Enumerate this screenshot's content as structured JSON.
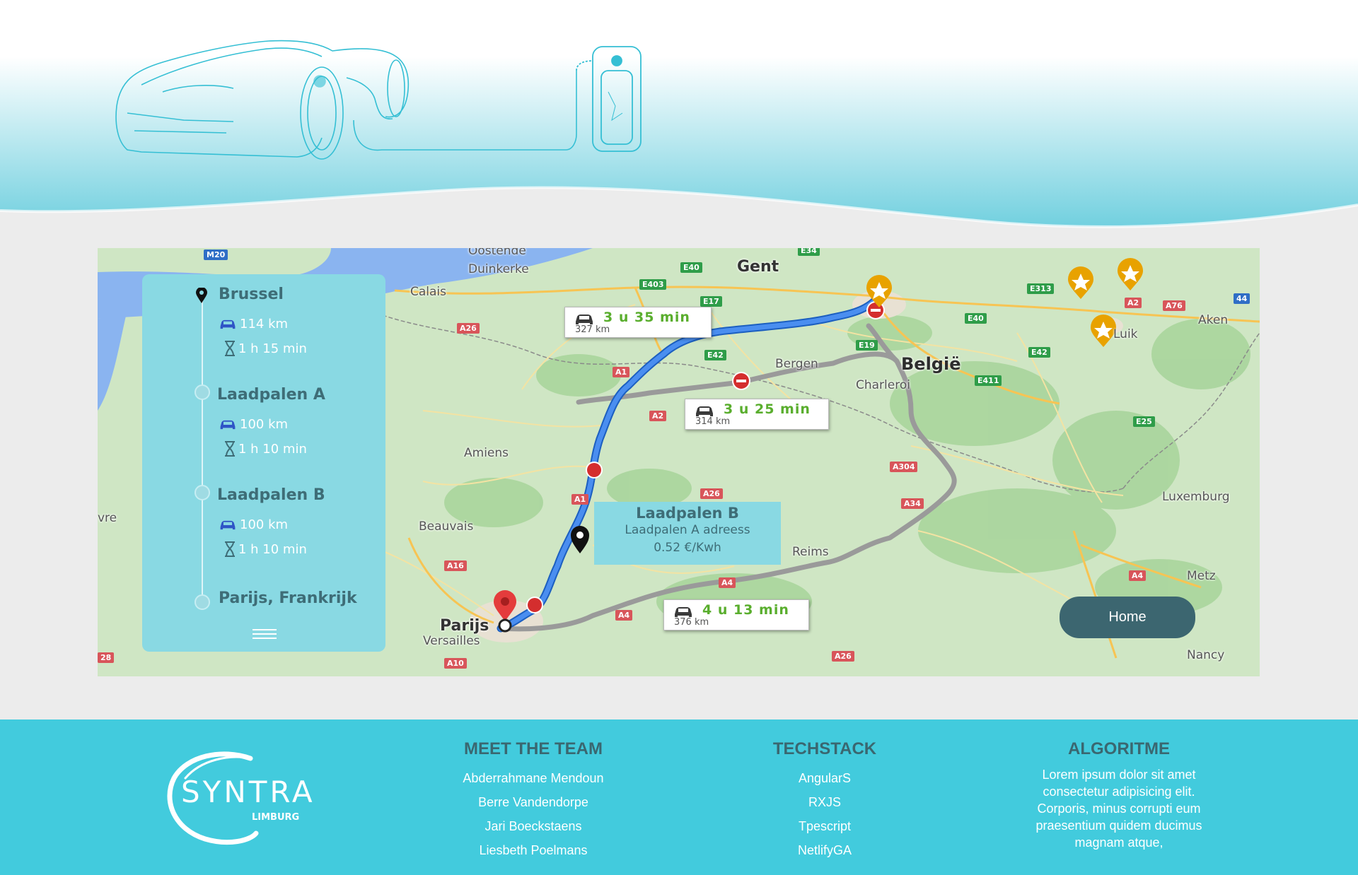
{
  "map": {
    "places": {
      "gent": "Gent",
      "duinkerke": "Duinkerke",
      "calais": "Calais",
      "oostende": "Oostende",
      "bergen": "Bergen",
      "charleroi": "Charleroi",
      "belgie": "België",
      "amiens": "Amiens",
      "beauvais": "Beauvais",
      "parijs": "Parijs",
      "versailles": "Versailles",
      "reims": "Reims",
      "luxemburg": "Luxemburg",
      "metz": "Metz",
      "nancy": "Nancy",
      "aken": "Aken",
      "luik": "Luik",
      "vre": "vre"
    },
    "highways": [
      "M20",
      "E40",
      "E34",
      "E403",
      "E17",
      "E313",
      "A2",
      "A76",
      "44",
      "E40",
      "E42",
      "A1",
      "A26",
      "E19",
      "E42",
      "E411",
      "A2",
      "A304",
      "E25",
      "A26",
      "A1",
      "A34",
      "A16",
      "A4",
      "A4",
      "A4",
      "A10",
      "A26",
      "28"
    ],
    "routes": [
      {
        "time": "3 u 35 min",
        "distance": "327 km"
      },
      {
        "time": "3 u 25 min",
        "distance": "314 km"
      },
      {
        "time": "4 u 13 min",
        "distance": "376 km"
      }
    ],
    "info_popup": {
      "title": "Laadpalen B",
      "address": "Laadpalen A adreess",
      "price": "0.52 €/Kwh"
    },
    "home_label": "Home"
  },
  "route_panel": {
    "stops": [
      {
        "name": "Brussel",
        "distance": "114 km",
        "duration": "1 h 15 min"
      },
      {
        "name": "Laadpalen A",
        "distance": "100 km",
        "duration": "1 h 10 min"
      },
      {
        "name": "Laadpalen B",
        "distance": "100 km",
        "duration": "1 h 10 min"
      },
      {
        "name": "Parijs, Frankrijk"
      }
    ]
  },
  "footer": {
    "logo": {
      "word": "SYNTRA",
      "sub": "LIMBURG"
    },
    "team": {
      "title": "MEET THE TEAM",
      "members": [
        "Abderrahmane Mendoun",
        "Berre Vandendorpe",
        "Jari Boeckstaens",
        "Liesbeth Poelmans"
      ]
    },
    "techstack": {
      "title": "TECHSTACK",
      "items": [
        "AngularS",
        "RXJS",
        "Tpescript",
        "NetlifyGA"
      ]
    },
    "algoritme": {
      "title": "ALGORITME",
      "text": "Lorem ipsum dolor sit amet consectetur adipisicing elit. Corporis, minus corrupti eum praesentium quidem ducimus magnam atque,"
    }
  },
  "colors": {
    "accent": "#42cbdd",
    "panel": "#89d9e3",
    "dark": "#3c6670",
    "route": "#3b7de0"
  }
}
